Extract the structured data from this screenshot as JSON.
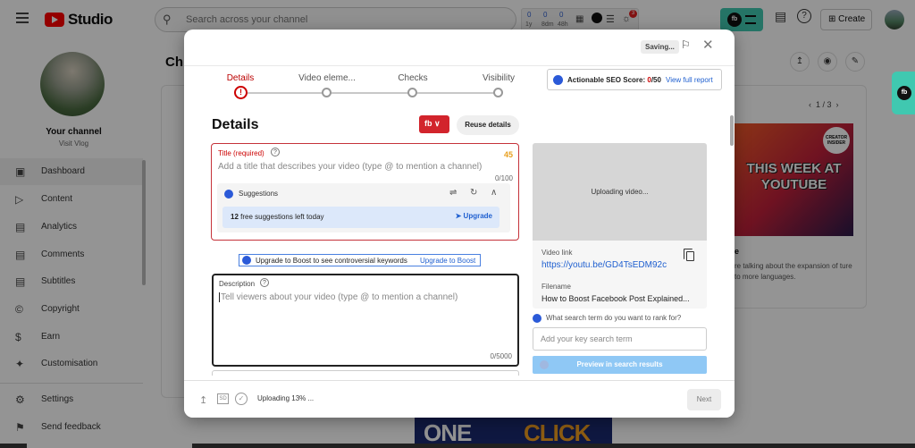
{
  "app": {
    "name": "Studio",
    "brand_color": "#ff0000"
  },
  "search": {
    "placeholder": "Search across your channel"
  },
  "extension_strip": {
    "stats": [
      "0",
      "0",
      "0"
    ],
    "labels": [
      "1y",
      "8dm",
      "48h"
    ]
  },
  "notifications_badge": "3",
  "header": {
    "create_label": "Create"
  },
  "channel": {
    "name": "Your channel",
    "subtitle": "Visit Vlog"
  },
  "sidebar": {
    "items": [
      {
        "label": "Dashboard",
        "icon": "dashboard-icon",
        "active": true
      },
      {
        "label": "Content",
        "icon": "content-icon"
      },
      {
        "label": "Analytics",
        "icon": "analytics-icon"
      },
      {
        "label": "Comments",
        "icon": "comments-icon"
      },
      {
        "label": "Subtitles",
        "icon": "subtitles-icon"
      },
      {
        "label": "Copyright",
        "icon": "copyright-icon"
      },
      {
        "label": "Earn",
        "icon": "earn-icon"
      },
      {
        "label": "Customisation",
        "icon": "customisation-icon"
      },
      {
        "label": "Settings",
        "icon": "settings-icon"
      },
      {
        "label": "Send feedback",
        "icon": "feedback-icon"
      }
    ]
  },
  "main": {
    "title_fragment": "Ch"
  },
  "news": {
    "pager": "1 / 3",
    "badge": "CREATOR INSIDER",
    "thumb_title": "THIS WEEK AT YOUTUBE",
    "title_fragment": "e",
    "desc": "re talking about the expansion of ture to more languages."
  },
  "bottom_thumb": {
    "word1": "ONE",
    "word2": "CLICK"
  },
  "modal": {
    "saving": "Saving...",
    "steps": [
      {
        "label": "Details",
        "active": true
      },
      {
        "label": "Video eleme..."
      },
      {
        "label": "Checks"
      },
      {
        "label": "Visibility"
      }
    ],
    "seo": {
      "label": "Actionable SEO Score:",
      "score": "0",
      "total": "/50",
      "link": "View full report"
    },
    "heading": "Details",
    "fb_badge": "fb",
    "reuse_label": "Reuse details",
    "title_field": {
      "label": "Title (required)",
      "placeholder": "Add a title that describes your video (type @ to mention a channel)",
      "score": "45",
      "count": "0/100"
    },
    "suggestions": {
      "label": "Suggestions",
      "free_count": "12",
      "free_text": "free suggestions left today",
      "upgrade_label": "Upgrade"
    },
    "boost": {
      "text": "Upgrade to Boost to see controversial keywords",
      "link": "Upgrade to Boost"
    },
    "description_field": {
      "label": "Description",
      "placeholder": "Tell viewers about your video (type @ to mention a channel)",
      "count": "0/5000"
    },
    "preview": {
      "uploading": "Uploading video...",
      "video_link_label": "Video link",
      "video_link": "https://youtu.be/GD4TsEDM92c",
      "filename_label": "Filename",
      "filename": "How to Boost Facebook Post Explained..."
    },
    "rank": {
      "question": "What search term do you want to rank for?",
      "placeholder": "Add your key search term",
      "button": "Preview in search results"
    },
    "footer": {
      "hd": "SD",
      "status": "Uploading 13% ...",
      "next_label": "Next"
    }
  }
}
